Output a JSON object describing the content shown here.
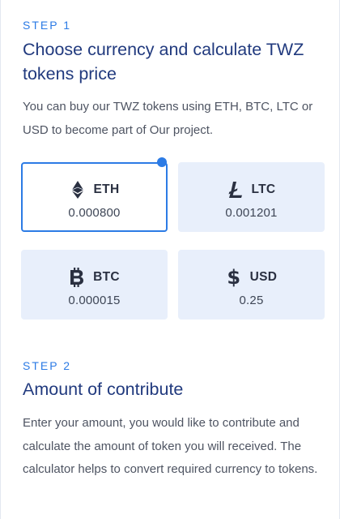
{
  "step1": {
    "label": "STEP 1",
    "title": "Choose currency and calculate TWZ tokens price",
    "description": "You can buy our TWZ tokens using ETH, BTC, LTC or USD to become part of Our project."
  },
  "currencies": [
    {
      "code": "ETH",
      "value": "0.000800",
      "icon": "ethereum-icon",
      "selected": true
    },
    {
      "code": "LTC",
      "value": "0.001201",
      "icon": "litecoin-icon",
      "selected": false
    },
    {
      "code": "BTC",
      "value": "0.000015",
      "icon": "bitcoin-icon",
      "selected": false
    },
    {
      "code": "USD",
      "value": "0.25",
      "icon": "dollar-icon",
      "selected": false
    }
  ],
  "step2": {
    "label": "STEP 2",
    "title": "Amount of contribute",
    "description": "Enter your amount, you would like to contribute and calculate the amount of token you will received. The calculator helps to convert required currency to tokens."
  },
  "colors": {
    "accent": "#2c7be5",
    "title": "#213a7e",
    "card_bg": "#e8effb",
    "text": "#4e5462"
  }
}
